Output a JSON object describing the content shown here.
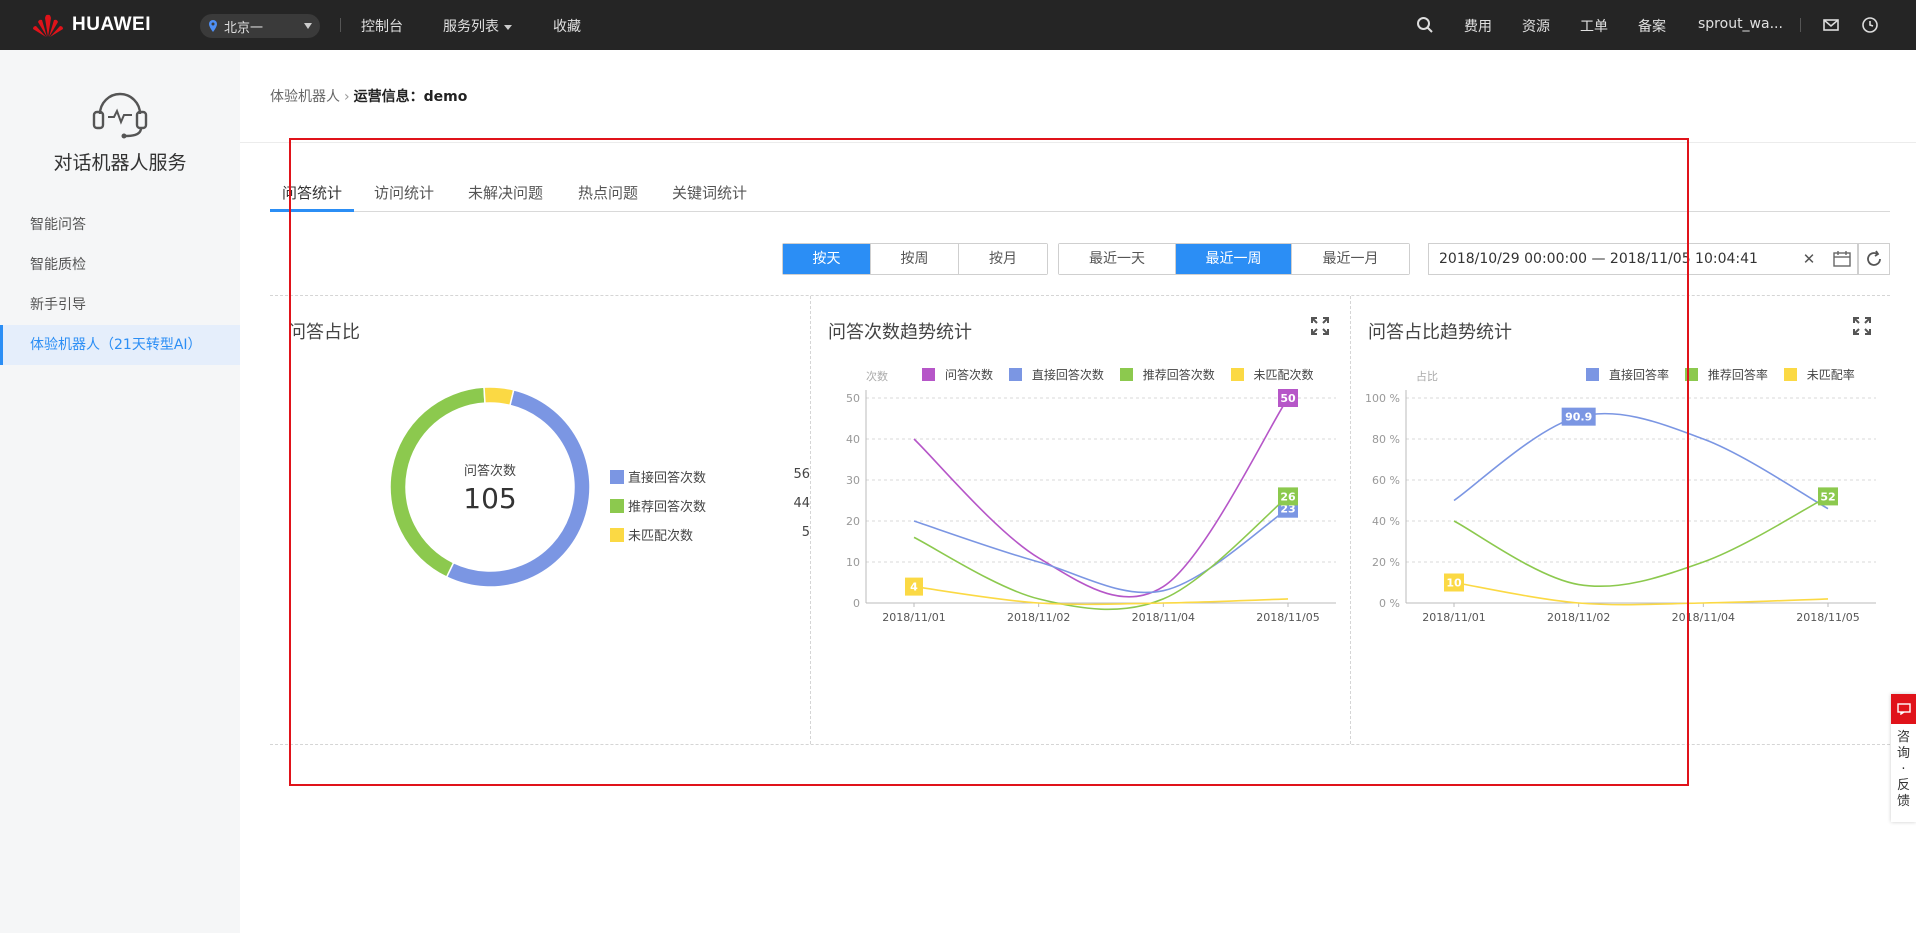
{
  "topbar": {
    "brand": "HUAWEI",
    "region": "北京一",
    "nav": [
      "控制台",
      "服务列表",
      "收藏"
    ],
    "right_links": [
      "费用",
      "资源",
      "工单",
      "备案"
    ],
    "user": "sprout_wa..."
  },
  "sidebar": {
    "service_title": "对话机器人服务",
    "items": [
      {
        "label": "智能问答",
        "active": false
      },
      {
        "label": "智能质检",
        "active": false
      },
      {
        "label": "新手引导",
        "active": false
      },
      {
        "label": "体验机器人（21天转型AI）",
        "active": true
      }
    ]
  },
  "breadcrumb": {
    "parent": "体验机器人",
    "current": "运营信息：demo"
  },
  "tabs": [
    "问答统计",
    "访问统计",
    "未解决问题",
    "热点问题",
    "关键词统计"
  ],
  "granularity": {
    "options": [
      "按天",
      "按周",
      "按月"
    ],
    "selected": "按天"
  },
  "range": {
    "options": [
      "最近一天",
      "最近一周",
      "最近一月"
    ],
    "selected": "最近一周"
  },
  "daterange": {
    "value": "2018/10/29 00:00:00 — 2018/11/05 10:04:41"
  },
  "accent": "#2b8ef5",
  "panels": {
    "ratio_title": "问答占比",
    "trend_count_title": "问答次数趋势统计",
    "trend_ratio_title": "问答占比趋势统计"
  },
  "chart_data": [
    {
      "type": "pie",
      "title": "问答占比",
      "center_label": "问答次数",
      "center_value": "105",
      "slices": [
        {
          "name": "直接回答次数",
          "value": 56,
          "color": "#7b96e3"
        },
        {
          "name": "推荐回答次数",
          "value": 44,
          "color": "#8cc94e"
        },
        {
          "name": "未匹配次数",
          "value": 5,
          "color": "#fbd944"
        }
      ]
    },
    {
      "type": "line",
      "title": "问答次数趋势统计",
      "ylabel": "次数",
      "ylim": [
        0,
        50
      ],
      "yticks": [
        0,
        10,
        20,
        30,
        40,
        50
      ],
      "x": [
        "2018/11/01",
        "2018/11/02",
        "2018/11/04",
        "2018/11/05"
      ],
      "series": [
        {
          "name": "问答次数",
          "color": "#b656c8",
          "values": [
            40,
            11,
            4,
            50
          ],
          "end_label": "50"
        },
        {
          "name": "直接回答次数",
          "color": "#7b96e3",
          "values": [
            20,
            10,
            3,
            23
          ],
          "end_label": "23"
        },
        {
          "name": "推荐回答次数",
          "color": "#8cc94e",
          "values": [
            16,
            1,
            1,
            26
          ],
          "end_label": "26"
        },
        {
          "name": "未匹配次数",
          "color": "#fbd944",
          "values": [
            4,
            0,
            0,
            1
          ],
          "start_label": "4"
        }
      ]
    },
    {
      "type": "line",
      "title": "问答占比趋势统计",
      "ylabel": "占比",
      "ylim": [
        0,
        100
      ],
      "yticks": [
        "0 %",
        "20 %",
        "40 %",
        "60 %",
        "80 %",
        "100 %"
      ],
      "x": [
        "2018/11/01",
        "2018/11/02",
        "2018/11/04",
        "2018/11/05"
      ],
      "series": [
        {
          "name": "直接回答率",
          "color": "#7b96e3",
          "values": [
            50,
            90.9,
            80,
            46
          ],
          "peak_label": "90.9"
        },
        {
          "name": "推荐回答率",
          "color": "#8cc94e",
          "values": [
            40,
            9,
            20,
            52
          ],
          "end_label": "52"
        },
        {
          "name": "未匹配率",
          "color": "#fbd944",
          "values": [
            10,
            0,
            0,
            2
          ],
          "start_label": "10"
        }
      ]
    }
  ],
  "feedback": {
    "label": "咨询·反馈"
  }
}
